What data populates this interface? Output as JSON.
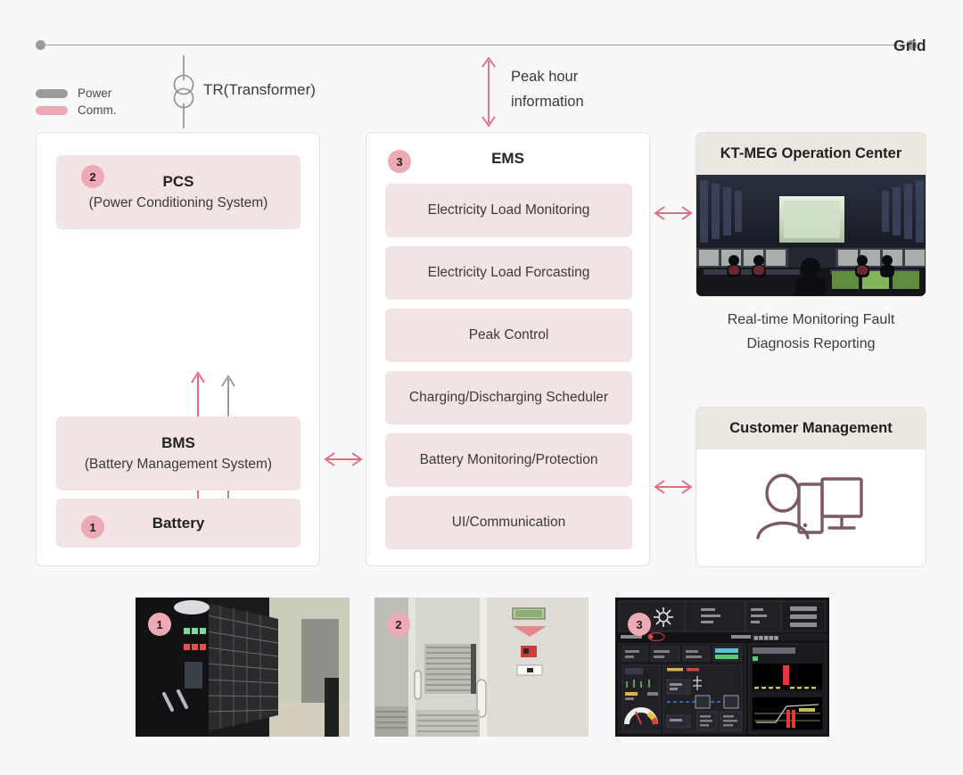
{
  "grid": {
    "label": "Grid"
  },
  "legend": {
    "items": [
      {
        "label": "Power",
        "color": "#9a9a9a",
        "icon": "power-line-swatch"
      },
      {
        "label": "Comm.",
        "color": "#efa9b4",
        "icon": "comm-line-swatch"
      }
    ]
  },
  "transformer": {
    "label": "TR(Transformer)",
    "icon": "transformer-symbol-icon"
  },
  "peak_hour": {
    "line1": "Peak hour",
    "line2": "information",
    "arrow_icon": "double-headed-vertical-arrow-icon",
    "arrow_color": "#e26b7f"
  },
  "pcs_panel": {
    "pcs": {
      "badge": "2",
      "title": "PCS",
      "subtitle": "(Power Conditioning System)"
    },
    "bms": {
      "title": "BMS",
      "subtitle": "(Battery Management System)"
    },
    "battery": {
      "badge": "1",
      "title": "Battery"
    },
    "arrows": {
      "comm_icon": "comm-double-arrow-icon",
      "power_icon": "power-double-arrow-icon"
    }
  },
  "ems_panel": {
    "badge": "3",
    "title": "EMS",
    "items": [
      {
        "label": "Electricity Load Monitoring"
      },
      {
        "label": "Electricity Load Forcasting"
      },
      {
        "label": "Peak Control"
      },
      {
        "label": "Charging/Discharging Scheduler"
      },
      {
        "label": "Battery Monitoring/Protection"
      },
      {
        "label": "UI/Communication"
      }
    ]
  },
  "operation_center": {
    "title": "KT-MEG Operation Center",
    "photo_icon": "control-room-photo",
    "caption_line1": "Real-time Monitoring Fault",
    "caption_line2": "Diagnosis Reporting"
  },
  "customer_management": {
    "title": "Customer Management",
    "icon": "person-with-monitor-icon",
    "icon_color": "#7a5a5e"
  },
  "connectors": {
    "bms_to_ems": "double-headed-horizontal-arrow-icon",
    "ems_to_operation_center": "double-headed-horizontal-arrow-icon",
    "ems_to_customer": "double-headed-horizontal-arrow-icon",
    "color": "#e26b7f"
  },
  "photos": [
    {
      "badge": "1",
      "name": "battery-rack-photo"
    },
    {
      "badge": "2",
      "name": "pcs-cabinet-photo"
    },
    {
      "badge": "3",
      "name": "ems-dashboard-photo"
    }
  ],
  "colors": {
    "background": "#f8f8f8",
    "pink_fill": "#f3e3e5",
    "badge_pink": "#edaab4",
    "accent_pink": "#e26b7f",
    "gray_line": "#9a9a9a",
    "header_beige": "#ece7e0"
  }
}
